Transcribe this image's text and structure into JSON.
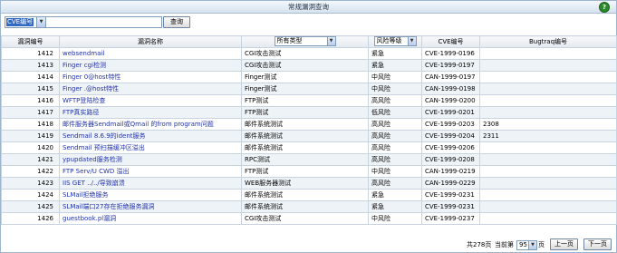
{
  "title": "常规漏洞查询",
  "help_icon": "?",
  "search": {
    "field_selected": "CVE编号",
    "keyword_value": "",
    "query_label": "查询"
  },
  "headers": {
    "id": "漏洞编号",
    "name": "漏洞名称",
    "type_selected": "所有类型",
    "risk_selected": "风险等级",
    "cve": "CVE编号",
    "bugtraq": "Bugtraq编号"
  },
  "rows": [
    {
      "id": "1412",
      "name": "websendmail",
      "type": "CGI攻击测试",
      "risk": "紧急",
      "cve": "CVE-1999-0196",
      "bugtraq": ""
    },
    {
      "id": "1413",
      "name": "Finger cgi检测",
      "type": "CGI攻击测试",
      "risk": "紧急",
      "cve": "CVE-1999-0197",
      "bugtraq": ""
    },
    {
      "id": "1414",
      "name": "Finger 0@host特性",
      "type": "Finger测试",
      "risk": "中风险",
      "cve": "CAN-1999-0197",
      "bugtraq": ""
    },
    {
      "id": "1415",
      "name": "Finger .@host特性",
      "type": "Finger测试",
      "risk": "中风险",
      "cve": "CAN-1999-0198",
      "bugtraq": ""
    },
    {
      "id": "1416",
      "name": "WFTP登陆检查",
      "type": "FTP测试",
      "risk": "高风险",
      "cve": "CAN-1999-0200",
      "bugtraq": ""
    },
    {
      "id": "1417",
      "name": "FTP真实路径",
      "type": "FTP测试",
      "risk": "低风险",
      "cve": "CVE-1999-0201",
      "bugtraq": ""
    },
    {
      "id": "1418",
      "name": "邮件服务器Sendmail或Qmail 的from program问题",
      "type": "邮件系统测试",
      "risk": "高风险",
      "cve": "CVE-1999-0203",
      "bugtraq": "2308"
    },
    {
      "id": "1419",
      "name": "Sendmail 8.6.9的ident服务",
      "type": "邮件系统测试",
      "risk": "高风险",
      "cve": "CVE-1999-0204",
      "bugtraq": "2311"
    },
    {
      "id": "1420",
      "name": "Sendmail 预扫描缓冲区溢出",
      "type": "邮件系统测试",
      "risk": "高风险",
      "cve": "CVE-1999-0206",
      "bugtraq": ""
    },
    {
      "id": "1421",
      "name": "ypupdated服务检测",
      "type": "RPC测试",
      "risk": "高风险",
      "cve": "CVE-1999-0208",
      "bugtraq": ""
    },
    {
      "id": "1422",
      "name": "FTP Serv/U CWD 溢出",
      "type": "FTP测试",
      "risk": "中风险",
      "cve": "CAN-1999-0219",
      "bugtraq": ""
    },
    {
      "id": "1423",
      "name": "IIS GET ../../导致崩溃",
      "type": "WEB服务器测试",
      "risk": "高风险",
      "cve": "CAN-1999-0229",
      "bugtraq": ""
    },
    {
      "id": "1424",
      "name": "SLMail拒绝服务",
      "type": "邮件系统测试",
      "risk": "紧急",
      "cve": "CVE-1999-0231",
      "bugtraq": ""
    },
    {
      "id": "1425",
      "name": "SLMail端口27存在拒绝服务漏洞",
      "type": "邮件系统测试",
      "risk": "紧急",
      "cve": "CVE-1999-0231",
      "bugtraq": ""
    },
    {
      "id": "1426",
      "name": "guestbook.pl漏洞",
      "type": "CGI攻击测试",
      "risk": "中风险",
      "cve": "CVE-1999-0237",
      "bugtraq": ""
    }
  ],
  "pagination": {
    "total_text": "共278页",
    "current_label": "当前第",
    "current_page": "95",
    "page_suffix": "页",
    "prev_label": "上一页",
    "next_label": "下一页"
  }
}
